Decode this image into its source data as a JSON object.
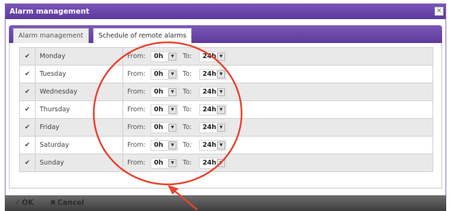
{
  "dialog": {
    "title": "Alarm management",
    "close_glyph": "×"
  },
  "tabs": [
    {
      "label": "Alarm management",
      "active": false
    },
    {
      "label": "Schedule of remote alarms",
      "active": true
    }
  ],
  "schedule": {
    "from_label": "From:",
    "to_label": "To:",
    "rows": [
      {
        "checked": "✔",
        "day": "Monday",
        "from": "0h",
        "to": "24h"
      },
      {
        "checked": "✔",
        "day": "Tuesday",
        "from": "0h",
        "to": "24h"
      },
      {
        "checked": "✔",
        "day": "Wednesday",
        "from": "0h",
        "to": "24h"
      },
      {
        "checked": "✔",
        "day": "Thursday",
        "from": "0h",
        "to": "24h"
      },
      {
        "checked": "✔",
        "day": "Friday",
        "from": "0h",
        "to": "24h"
      },
      {
        "checked": "✔",
        "day": "Saturday",
        "from": "0h",
        "to": "24h"
      },
      {
        "checked": "✔",
        "day": "Sunday",
        "from": "0h",
        "to": "24h"
      }
    ]
  },
  "footer": {
    "ok_icon": "✓",
    "ok_label": "OK",
    "cancel_icon": "✖",
    "cancel_label": "Cancel"
  },
  "colors": {
    "title_bar": "#5b3a9c",
    "annotation": "#e8432e"
  },
  "icons": {
    "dropdown": "chevron-down-icon",
    "close": "close-icon",
    "check": "checkmark-icon"
  }
}
